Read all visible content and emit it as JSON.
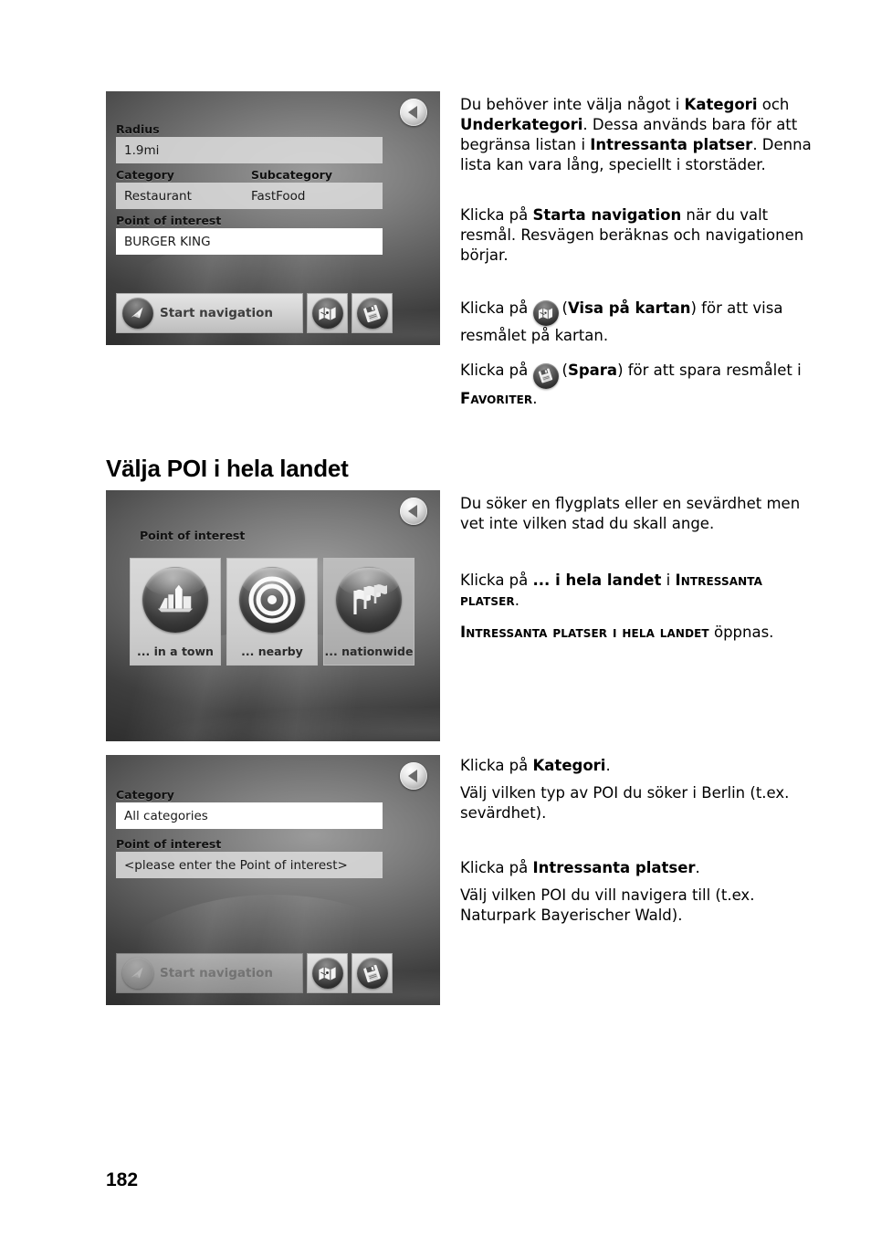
{
  "page": {
    "number": "182"
  },
  "heading": {
    "text": "Välja POI i hela landet"
  },
  "screens": {
    "poi_result": {
      "back_icon": "back-arrow-icon",
      "radius_label": "Radius",
      "radius_value": "1.9mi",
      "category_label": "Category",
      "subcategory_label": "Subcategory",
      "category_value": "Restaurant",
      "subcategory_value": "FastFood",
      "poi_label": "Point of interest",
      "poi_value": "BURGER KING",
      "start_navigation_label": "Start navigation",
      "map_button_icon": "show-on-map-icon",
      "save_button_icon": "save-icon"
    },
    "poi_chooser": {
      "back_icon": "back-arrow-icon",
      "title": "Point of interest",
      "tiles": [
        {
          "label": "... in a town",
          "icon": "city-skyline-icon"
        },
        {
          "label": "... nearby",
          "icon": "target-rings-icon"
        },
        {
          "label": "... nationwide",
          "icon": "flags-icon"
        }
      ]
    },
    "poi_nationwide": {
      "back_icon": "back-arrow-icon",
      "category_label": "Category",
      "category_value": "All categories",
      "poi_label": "Point of interest",
      "poi_value": "<please enter the Point of interest>",
      "start_navigation_label": "Start navigation",
      "map_button_icon": "show-on-map-icon",
      "save_button_icon": "save-icon"
    }
  },
  "copy": {
    "block1": {
      "p1_a": "Du behöver inte välja något i ",
      "p1_b1": "Kategori",
      "p1_c": " och ",
      "p1_b2": "Underkategori",
      "p1_d": ". Dessa används bara för att begränsa listan i ",
      "p1_b3": "Intressanta platser",
      "p1_e": ". Denna lista kan vara lång, speciellt i storstäder.",
      "p2_a": "Klicka på ",
      "p2_b": "Starta navigation",
      "p2_c": " när du valt resmål. Resvägen beräknas och navigationen börjar.",
      "p3_a": "Klicka på ",
      "p3_b": "(",
      "p3_c": "Visa på kartan",
      "p3_d": ") för att visa resmålet på kartan.",
      "p4_a": "Klicka på ",
      "p4_b": "(",
      "p4_c": "Spara",
      "p4_d": ") för att spara resmålet i ",
      "p4_sc": "Favoriter",
      "p4_e": "."
    },
    "block2": {
      "p1": "Du söker en flygplats eller en sevärdhet men vet inte vilken stad du skall ange.",
      "p2_a": "Klicka på ",
      "p2_b": "... i hela landet",
      "p2_c": " i ",
      "p2_sc": "Intressanta platser",
      "p2_d": ".",
      "p3_sc": "Intressanta platser i hela landet",
      "p3_b": " öppnas."
    },
    "block3": {
      "p1_a": "Klicka på ",
      "p1_b": "Kategori",
      "p1_c": ".",
      "p2": "Välj vilken typ av POI du söker i Berlin (t.ex. sevärdhet).",
      "p3_a": "Klicka på ",
      "p3_b": "Intressanta platser",
      "p3_c": ".",
      "p4": "Välj vilken POI du vill navigera till (t.ex. Naturpark Bayerischer Wald)."
    }
  },
  "colors": {
    "page_bg": "#ffffff",
    "text": "#000000",
    "screen_dark": "#3e3e3e",
    "field_grey": "#dbdbdb",
    "field_white": "#ffffff",
    "button_face": "#d2d2d2"
  }
}
